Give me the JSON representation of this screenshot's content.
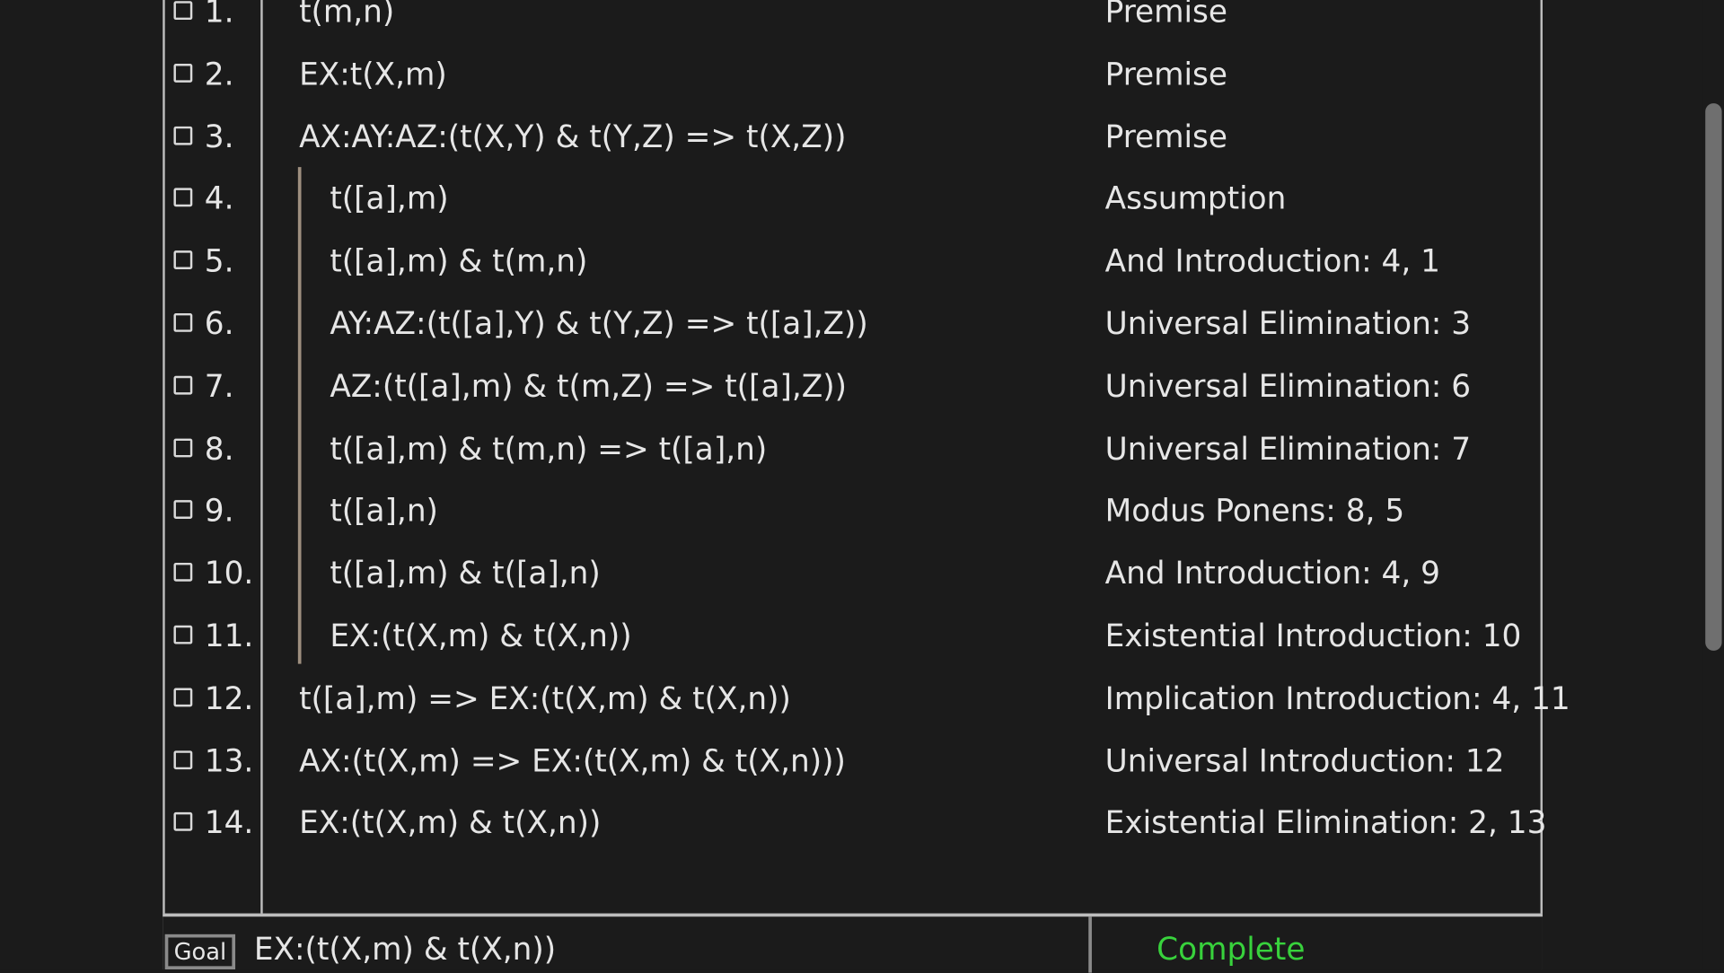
{
  "proof": {
    "lines": [
      {
        "num": "1.",
        "formula": "t(m,n)",
        "reason": "Premise",
        "depth": 0
      },
      {
        "num": "2.",
        "formula": "EX:t(X,m)",
        "reason": "Premise",
        "depth": 0
      },
      {
        "num": "3.",
        "formula": "AX:AY:AZ:(t(X,Y) & t(Y,Z) => t(X,Z))",
        "reason": "Premise",
        "depth": 0
      },
      {
        "num": "4.",
        "formula": "t([a],m)",
        "reason": "Assumption",
        "depth": 1
      },
      {
        "num": "5.",
        "formula": "t([a],m) & t(m,n)",
        "reason": "And Introduction: 4, 1",
        "depth": 1
      },
      {
        "num": "6.",
        "formula": "AY:AZ:(t([a],Y) & t(Y,Z) => t([a],Z))",
        "reason": "Universal Elimination: 3",
        "depth": 1
      },
      {
        "num": "7.",
        "formula": "AZ:(t([a],m) & t(m,Z) => t([a],Z))",
        "reason": "Universal Elimination: 6",
        "depth": 1
      },
      {
        "num": "8.",
        "formula": "t([a],m) & t(m,n) => t([a],n)",
        "reason": "Universal Elimination: 7",
        "depth": 1
      },
      {
        "num": "9.",
        "formula": "t([a],n)",
        "reason": "Modus Ponens: 8, 5",
        "depth": 1
      },
      {
        "num": "10.",
        "formula": "t([a],m) & t([a],n)",
        "reason": "And Introduction: 4, 9",
        "depth": 1
      },
      {
        "num": "11.",
        "formula": "EX:(t(X,m) & t(X,n))",
        "reason": "Existential Introduction: 10",
        "depth": 1
      },
      {
        "num": "12.",
        "formula": "t([a],m) => EX:(t(X,m) & t(X,n))",
        "reason": "Implication Introduction: 4, 11",
        "depth": 0
      },
      {
        "num": "13.",
        "formula": "AX:(t(X,m) => EX:(t(X,m) & t(X,n)))",
        "reason": "Universal Introduction: 12",
        "depth": 0
      },
      {
        "num": "14.",
        "formula": "EX:(t(X,m) & t(X,n))",
        "reason": "Existential Elimination: 2, 13",
        "depth": 0
      }
    ]
  },
  "goal": {
    "button_label": "Goal",
    "value": "EX:(t(X,m) & t(X,n))",
    "status": "Complete",
    "status_color": "#38d23c"
  }
}
